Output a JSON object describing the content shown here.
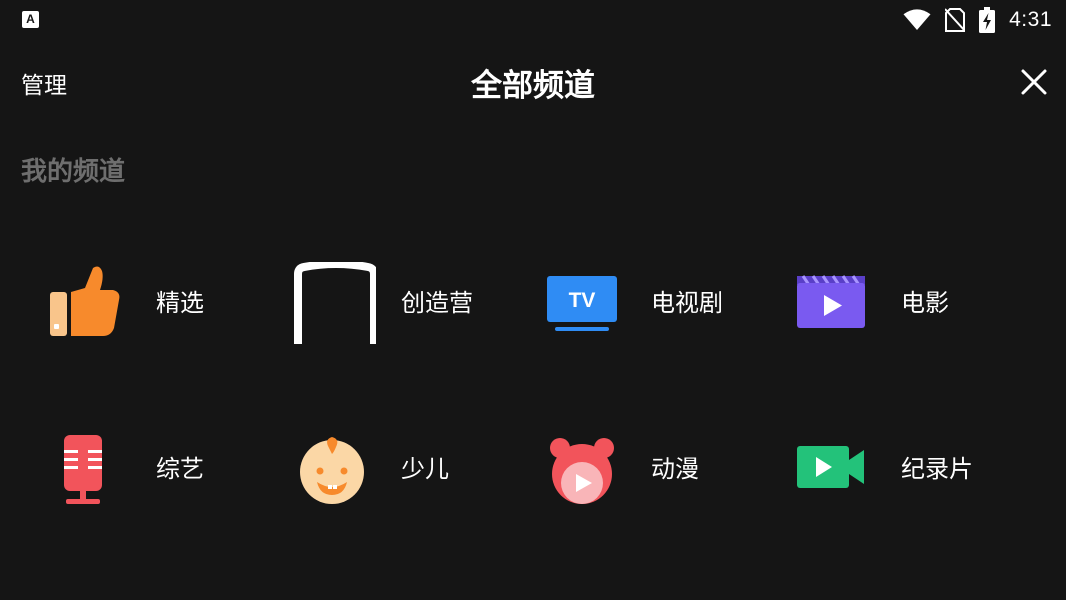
{
  "status_bar": {
    "app_icon_letter": "A",
    "time": "4:31",
    "icons": [
      "wifi-icon",
      "no-sim-icon",
      "battery-charging-icon"
    ]
  },
  "header": {
    "manage_label": "管理",
    "title": "全部频道",
    "close_icon": "close-icon"
  },
  "section": {
    "title": "我的频道"
  },
  "channels": [
    {
      "label": "精选",
      "icon": "thumbs-up-icon",
      "color": "#f78a2c"
    },
    {
      "label": "创造营",
      "icon": "camp-frame-icon",
      "color": "#ffffff"
    },
    {
      "label": "电视剧",
      "icon": "tv-icon",
      "color": "#2f8cf4"
    },
    {
      "label": "电影",
      "icon": "movie-clapper-icon",
      "color": "#7a5af0"
    },
    {
      "label": "综艺",
      "icon": "microphone-icon",
      "color": "#f2545b"
    },
    {
      "label": "少儿",
      "icon": "baby-face-icon",
      "color": "#fbd7a6"
    },
    {
      "label": "动漫",
      "icon": "cartoon-mouse-icon",
      "color": "#f2545b"
    },
    {
      "label": "纪录片",
      "icon": "video-camera-icon",
      "color": "#23c27a"
    }
  ]
}
